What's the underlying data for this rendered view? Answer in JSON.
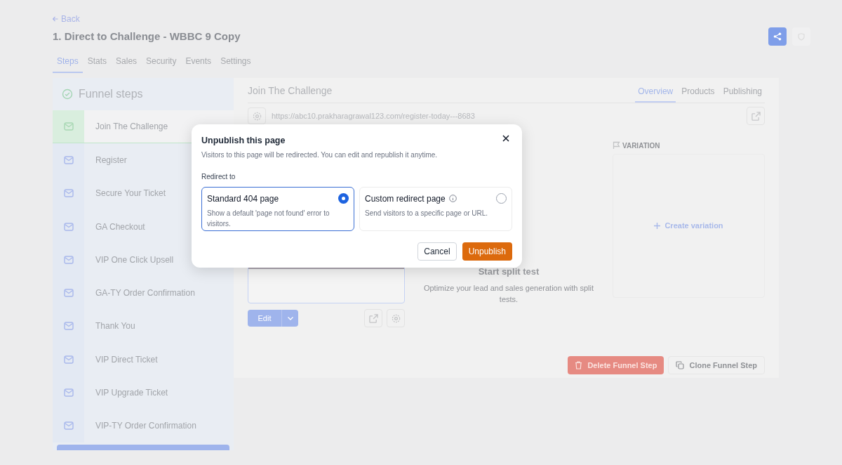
{
  "back_link": "Back",
  "page_title": "1. Direct to Challenge - WBBC 9 Copy",
  "tabs": [
    {
      "label": "Steps",
      "selected": true
    },
    {
      "label": "Stats",
      "selected": false
    },
    {
      "label": "Sales",
      "selected": false
    },
    {
      "label": "Security",
      "selected": false
    },
    {
      "label": "Events",
      "selected": false
    },
    {
      "label": "Settings",
      "selected": false
    }
  ],
  "funnel_steps": {
    "title": "Funnel steps",
    "steps": [
      {
        "label": "Join The Challenge",
        "selected": true
      },
      {
        "label": "Register",
        "selected": false
      },
      {
        "label": "Secure Your Ticket",
        "selected": false
      },
      {
        "label": "GA Checkout",
        "selected": false
      },
      {
        "label": "VIP One Click Upsell",
        "selected": false
      },
      {
        "label": "GA-TY Order Confirmation",
        "selected": false
      },
      {
        "label": "Thank You",
        "selected": false
      },
      {
        "label": "VIP Direct Ticket",
        "selected": false
      },
      {
        "label": "VIP Upgrade Ticket",
        "selected": false
      },
      {
        "label": "VIP-TY Order Confirmation",
        "selected": false
      }
    ]
  },
  "step_detail": {
    "title": "Join The Challenge",
    "tabs": [
      {
        "label": "Overview",
        "selected": true
      },
      {
        "label": "Products",
        "selected": false
      },
      {
        "label": "Publishing",
        "selected": false
      }
    ],
    "url": "https://abc10.prakharagrawal123.com/register-today---8683",
    "edit_button": "Edit",
    "split_test": {
      "title": "Start split test",
      "description": "Optimize your lead and sales generation with split tests."
    },
    "variation": {
      "label": "VARIATION",
      "action": "Create variation"
    },
    "actions": [
      {
        "label": "Delete Funnel Step",
        "kind": "danger"
      },
      {
        "label": "Clone Funnel Step",
        "kind": "secondary"
      }
    ]
  },
  "dialog": {
    "title": "Unpublish this page",
    "description": "Visitors to this page will be redirected. You can edit and republish it anytime.",
    "section_label": "Redirect to",
    "options": [
      {
        "title": "Standard 404 page",
        "description": "Show a default 'page not found' error to visitors.",
        "selected": true,
        "info": false
      },
      {
        "title": "Custom redirect page",
        "description": "Send visitors to a specific page or URL.",
        "selected": false,
        "info": true
      }
    ],
    "buttons": [
      {
        "label": "Cancel",
        "kind": "secondary"
      },
      {
        "label": "Unpublish",
        "kind": "primary"
      }
    ]
  }
}
